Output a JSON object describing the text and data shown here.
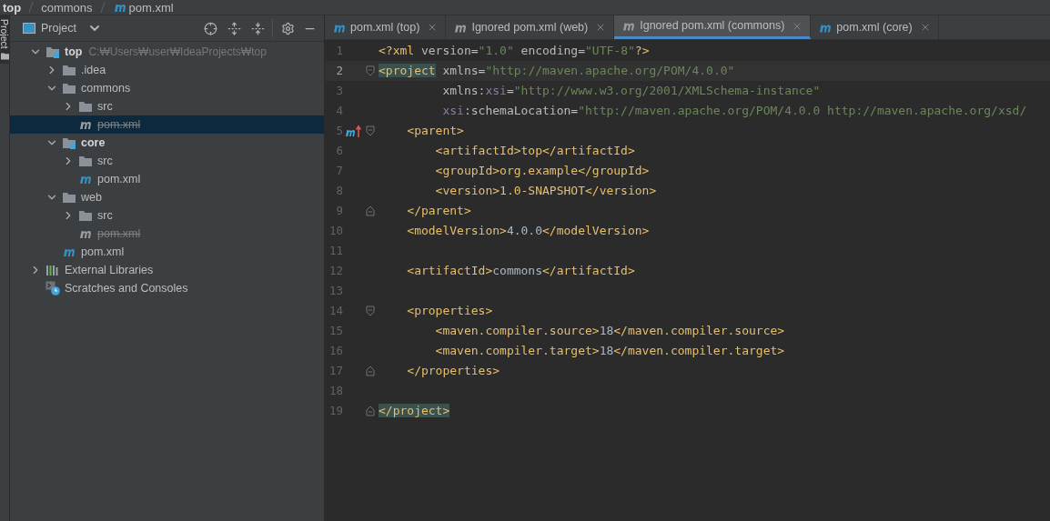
{
  "breadcrumb": [
    {
      "label": "top",
      "kind": "module"
    },
    {
      "label": "commons",
      "kind": "folder"
    },
    {
      "label": "pom.xml",
      "kind": "maven"
    }
  ],
  "side_tab": {
    "label": "Project",
    "selected": true
  },
  "project_panel": {
    "title": "Project"
  },
  "tree": [
    {
      "label": "top",
      "kind": "module",
      "hint": "C:₩Users₩user₩IdeaProjects₩top",
      "expanded": true,
      "selected": false,
      "children": [
        {
          "label": ".idea",
          "kind": "folder",
          "expanded": false,
          "selected": false
        },
        {
          "label": "commons",
          "kind": "folder",
          "expanded": true,
          "selected": false,
          "children": [
            {
              "label": "src",
              "kind": "folder",
              "expanded": false,
              "selected": false
            },
            {
              "label": "pom.xml",
              "kind": "maven",
              "ignored": true,
              "selected": true
            }
          ]
        },
        {
          "label": "core",
          "kind": "module",
          "expanded": true,
          "selected": false,
          "children": [
            {
              "label": "src",
              "kind": "folder",
              "expanded": false,
              "selected": false
            },
            {
              "label": "pom.xml",
              "kind": "maven",
              "ignored": false,
              "selected": false
            }
          ]
        },
        {
          "label": "web",
          "kind": "folder",
          "expanded": true,
          "selected": false,
          "children": [
            {
              "label": "src",
              "kind": "folder",
              "expanded": false,
              "selected": false
            },
            {
              "label": "pom.xml",
              "kind": "maven",
              "ignored": true,
              "selected": false
            }
          ]
        },
        {
          "label": "pom.xml",
          "kind": "maven",
          "ignored": false,
          "selected": false
        }
      ]
    },
    {
      "label": "External Libraries",
      "kind": "libraries",
      "expanded": false,
      "selected": false
    },
    {
      "label": "Scratches and Consoles",
      "kind": "scratches",
      "selected": false
    }
  ],
  "tabs": [
    {
      "label": "pom.xml (top)",
      "ignored": false,
      "selected": false
    },
    {
      "label": "Ignored pom.xml (web)",
      "ignored": true,
      "selected": false
    },
    {
      "label": "Ignored pom.xml (commons)",
      "ignored": true,
      "selected": true
    },
    {
      "label": "pom.xml (core)",
      "ignored": false,
      "selected": false
    }
  ],
  "editor": {
    "lines": [
      {
        "number": "1",
        "kind": "plain",
        "current": false,
        "tokens": [
          {
            "kind": "tag",
            "text": "<?xml"
          },
          {
            "kind": "attr",
            "text": " version="
          },
          {
            "kind": "value",
            "text": "\"1.0\""
          },
          {
            "kind": "attr",
            "text": " encoding="
          },
          {
            "kind": "value",
            "text": "\"UTF-8\""
          },
          {
            "kind": "tag",
            "text": "?>"
          }
        ]
      },
      {
        "number": "2",
        "kind": "fold-start",
        "current": true,
        "tokens": [
          {
            "kind": "tag-match",
            "text": "<project"
          },
          {
            "kind": "attr",
            "text": " xmlns="
          },
          {
            "kind": "value",
            "text": "\"http://maven.apache.org/POM/4.0.0\""
          }
        ]
      },
      {
        "number": "3",
        "kind": "plain",
        "current": false,
        "tokens": [
          {
            "kind": "attr",
            "text": "         xmlns:"
          },
          {
            "kind": "ns",
            "text": "xsi"
          },
          {
            "kind": "attr",
            "text": "="
          },
          {
            "kind": "value",
            "text": "\"http://www.w3.org/2001/XMLSchema-instance\""
          }
        ]
      },
      {
        "number": "4",
        "kind": "plain",
        "current": false,
        "tokens": [
          {
            "kind": "ns",
            "text": "         xsi"
          },
          {
            "kind": "attr",
            "text": ":schemaLocation="
          },
          {
            "kind": "value",
            "text": "\"http://maven.apache.org/POM/4.0.0 http://maven.apache.org/xsd/"
          }
        ]
      },
      {
        "number": "5",
        "kind": "fold-start",
        "parent_marker": true,
        "current": false,
        "tokens": [
          {
            "kind": "tag",
            "text": "    <parent>"
          }
        ]
      },
      {
        "number": "6",
        "kind": "plain",
        "current": false,
        "tokens": [
          {
            "kind": "tag",
            "text": "        <artifactId>top</artifactId>"
          }
        ]
      },
      {
        "number": "7",
        "kind": "plain",
        "current": false,
        "tokens": [
          {
            "kind": "tag",
            "text": "        <groupId>org.example</groupId>"
          }
        ]
      },
      {
        "number": "8",
        "kind": "plain",
        "current": false,
        "tokens": [
          {
            "kind": "tag",
            "text": "        <version>1.0-SNAPSHOT</version>"
          }
        ]
      },
      {
        "number": "9",
        "kind": "fold-end",
        "current": false,
        "tokens": [
          {
            "kind": "tag",
            "text": "    </parent>"
          }
        ]
      },
      {
        "number": "10",
        "kind": "plain",
        "current": false,
        "tokens": [
          {
            "kind": "tag",
            "text": "    <modelVersion>"
          },
          {
            "kind": "text",
            "text": "4.0.0"
          },
          {
            "kind": "tag",
            "text": "</modelVersion>"
          }
        ]
      },
      {
        "number": "11",
        "kind": "plain",
        "current": false
      },
      {
        "number": "12",
        "kind": "plain",
        "current": false,
        "tokens": [
          {
            "kind": "tag",
            "text": "    <artifactId>"
          },
          {
            "kind": "text",
            "text": "commons"
          },
          {
            "kind": "tag",
            "text": "</artifactId>"
          }
        ]
      },
      {
        "number": "13",
        "kind": "plain",
        "current": false
      },
      {
        "number": "14",
        "kind": "fold-start",
        "current": false,
        "tokens": [
          {
            "kind": "tag",
            "text": "    <properties>"
          }
        ]
      },
      {
        "number": "15",
        "kind": "plain",
        "current": false,
        "tokens": [
          {
            "kind": "tag",
            "text": "        <maven.compiler.source>"
          },
          {
            "kind": "text",
            "text": "18"
          },
          {
            "kind": "tag",
            "text": "</maven.compiler.source>"
          }
        ]
      },
      {
        "number": "16",
        "kind": "plain",
        "current": false,
        "tokens": [
          {
            "kind": "tag",
            "text": "        <maven.compiler.target>"
          },
          {
            "kind": "text",
            "text": "18"
          },
          {
            "kind": "tag",
            "text": "</maven.compiler.target>"
          }
        ]
      },
      {
        "number": "17",
        "kind": "fold-end",
        "current": false,
        "tokens": [
          {
            "kind": "tag",
            "text": "    </properties>"
          }
        ]
      },
      {
        "number": "18",
        "kind": "plain",
        "current": false
      },
      {
        "number": "19",
        "kind": "fold-end",
        "current": false,
        "tokens": [
          {
            "kind": "tag-match",
            "text": "</project>"
          }
        ]
      }
    ]
  }
}
